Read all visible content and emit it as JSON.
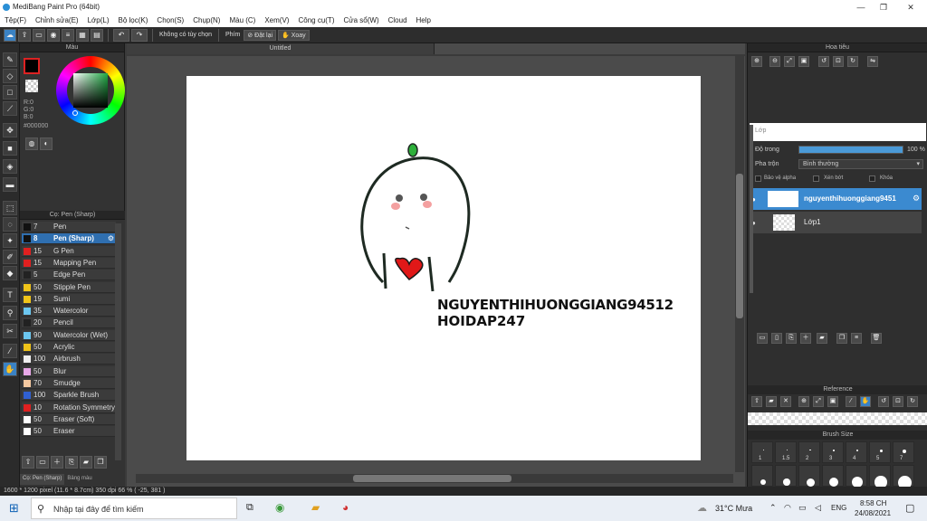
{
  "window": {
    "title": "MediBang Paint Pro (64bit)"
  },
  "menu": [
    "Tệp(F)",
    "Chỉnh sửa(E)",
    "Lớp(L)",
    "Bộ lọc(K)",
    "Chọn(S)",
    "Chụp(N)",
    "Màu (C)",
    "Xem(V)",
    "Công cụ(T)",
    "Cửa sổ(W)",
    "Cloud",
    "Help"
  ],
  "toolbar": {
    "snap_label": "Không có tùy chọn",
    "key_label": "Phím",
    "reset_label": "Đặt lại",
    "rotate_label": "Xoay"
  },
  "color_panel": {
    "title": "Màu",
    "r": "R:0",
    "g": "G:0",
    "b": "B:0",
    "hex": "#000000",
    "primary_color": "#000000"
  },
  "brush_panel": {
    "title": "Cọ: Pen (Sharp)",
    "brushes": [
      {
        "size": "7",
        "name": "Pen",
        "color": "#111111"
      },
      {
        "size": "8",
        "name": "Pen (Sharp)",
        "color": "#111111",
        "selected": true
      },
      {
        "size": "15",
        "name": "G Pen",
        "color": "#e02020"
      },
      {
        "size": "15",
        "name": "Mapping Pen",
        "color": "#e02020"
      },
      {
        "size": "5",
        "name": "Edge Pen",
        "color": "#222222"
      },
      {
        "size": "50",
        "name": "Stipple Pen",
        "color": "#f0c419"
      },
      {
        "size": "19",
        "name": "Sumi",
        "color": "#f0c419"
      },
      {
        "size": "35",
        "name": "Watercolor",
        "color": "#6cc7f0"
      },
      {
        "size": "20",
        "name": "Pencil",
        "color": "#222222"
      },
      {
        "size": "90",
        "name": "Watercolor (Wet)",
        "color": "#6cc7f0"
      },
      {
        "size": "50",
        "name": "Acrylic",
        "color": "#f0c419"
      },
      {
        "size": "100",
        "name": "Airbrush",
        "color": "#f0f0f0"
      },
      {
        "size": "50",
        "name": "Blur",
        "color": "#e8a8e8"
      },
      {
        "size": "70",
        "name": "Smudge",
        "color": "#f5c8a0"
      },
      {
        "size": "100",
        "name": "Sparkle Brush",
        "color": "#3060d0"
      },
      {
        "size": "10",
        "name": "Rotation Symmetry",
        "color": "#e02020"
      },
      {
        "size": "50",
        "name": "Eraser (Soft)",
        "color": "#ffffff"
      },
      {
        "size": "50",
        "name": "Eraser",
        "color": "#ffffff"
      }
    ],
    "tabs": [
      "Cọ: Pen (Sharp)",
      "Bảng màu"
    ]
  },
  "document": {
    "tab_title": "Untitled",
    "text_line1": "NGUYENTHIHUONGGIANG94512",
    "text_line2": "HOIDAP247"
  },
  "navigator": {
    "title": "Hoa tiêu"
  },
  "layer_panel": {
    "title": "Lớp",
    "opacity_label": "Độ trong",
    "opacity_value": "100 %",
    "opacity_fraction": 1.0,
    "blend_label": "Pha trộn",
    "blend_value": "Bình thường",
    "protect_alpha": "Bảo vệ alpha",
    "clipping": "Xén bớt",
    "lock": "Khóa",
    "layers": [
      {
        "name": "nguyenthihuonggiang9451",
        "selected": true
      },
      {
        "name": "Lớp1",
        "selected": false
      }
    ]
  },
  "reference": {
    "title": "Reference"
  },
  "brush_size": {
    "title": "Brush Size",
    "sizes": [
      "1",
      "1.5",
      "2",
      "3",
      "4",
      "5",
      "7"
    ]
  },
  "status": {
    "text": "1600 * 1200 pixel   (11.6 * 8.7cm)   350 dpi   66 %   ( -25, 381 )"
  },
  "taskbar": {
    "search_placeholder": "Nhập tại đây để tìm kiếm",
    "weather": "31°C  Mưa",
    "lang": "ENG",
    "time": "8:58 CH",
    "date": "24/08/2021"
  }
}
